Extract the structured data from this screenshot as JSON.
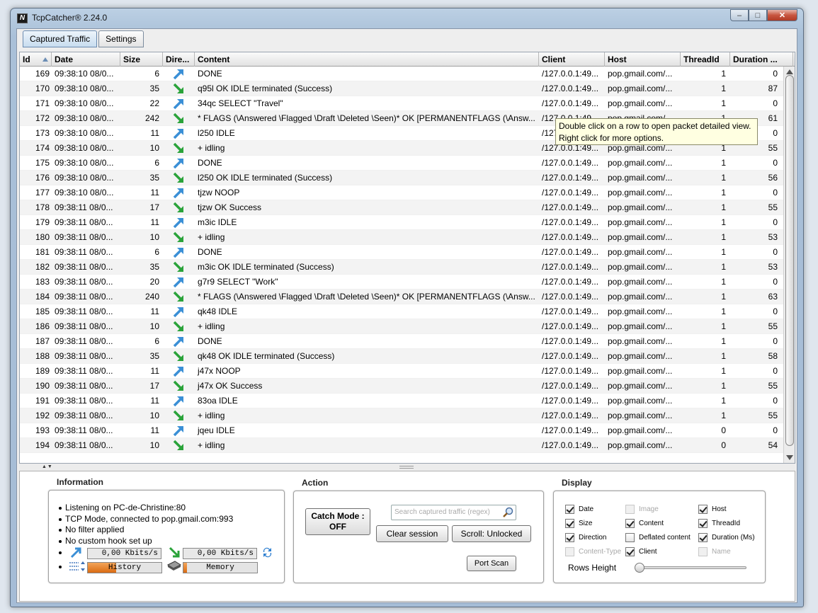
{
  "window": {
    "title": "TcpCatcher®  2.24.0",
    "app_icon_letter": "N"
  },
  "tabs": [
    {
      "label": "Captured Traffic",
      "active": true
    },
    {
      "label": "Settings",
      "active": false
    }
  ],
  "table": {
    "columns": [
      "Id",
      "Date",
      "Size",
      "Dire...",
      "Content",
      "Client",
      "Host",
      "ThreadId",
      "Duration ..."
    ],
    "sorted_column": "Id",
    "rows": [
      {
        "id": "169",
        "date": "09:38:10 08/0...",
        "size": "6",
        "dir": "out",
        "content": "DONE",
        "client": "/127.0.0.1:49...",
        "host": "pop.gmail.com/...",
        "thread": "1",
        "duration": "0"
      },
      {
        "id": "170",
        "date": "09:38:10 08/0...",
        "size": "35",
        "dir": "in",
        "content": "q95l OK IDLE terminated (Success)",
        "client": "/127.0.0.1:49...",
        "host": "pop.gmail.com/...",
        "thread": "1",
        "duration": "87"
      },
      {
        "id": "171",
        "date": "09:38:10 08/0...",
        "size": "22",
        "dir": "out",
        "content": "34qc SELECT \"Travel\"",
        "client": "/127.0.0.1:49...",
        "host": "pop.gmail.com/...",
        "thread": "1",
        "duration": "0"
      },
      {
        "id": "172",
        "date": "09:38:10 08/0...",
        "size": "242",
        "dir": "in",
        "content": "* FLAGS (\\Answered \\Flagged \\Draft \\Deleted \\Seen)* OK [PERMANENTFLAGS (\\Answ...",
        "client": "/127.0.0.1:49...",
        "host": "pop.gmail.com/...",
        "thread": "1",
        "duration": "61"
      },
      {
        "id": "173",
        "date": "09:38:10 08/0...",
        "size": "11",
        "dir": "out",
        "content": "l250 IDLE",
        "client": "/127.0.0.1:49...",
        "host": "pop.gmail.com/...",
        "thread": "1",
        "duration": "0"
      },
      {
        "id": "174",
        "date": "09:38:10 08/0...",
        "size": "10",
        "dir": "in",
        "content": "+ idling",
        "client": "/127.0.0.1:49...",
        "host": "pop.gmail.com/...",
        "thread": "1",
        "duration": "55"
      },
      {
        "id": "175",
        "date": "09:38:10 08/0...",
        "size": "6",
        "dir": "out",
        "content": "DONE",
        "client": "/127.0.0.1:49...",
        "host": "pop.gmail.com/...",
        "thread": "1",
        "duration": "0"
      },
      {
        "id": "176",
        "date": "09:38:10 08/0...",
        "size": "35",
        "dir": "in",
        "content": "l250 OK IDLE terminated (Success)",
        "client": "/127.0.0.1:49...",
        "host": "pop.gmail.com/...",
        "thread": "1",
        "duration": "56"
      },
      {
        "id": "177",
        "date": "09:38:10 08/0...",
        "size": "11",
        "dir": "out",
        "content": "tjzw NOOP",
        "client": "/127.0.0.1:49...",
        "host": "pop.gmail.com/...",
        "thread": "1",
        "duration": "0"
      },
      {
        "id": "178",
        "date": "09:38:11 08/0...",
        "size": "17",
        "dir": "in",
        "content": "tjzw OK Success",
        "client": "/127.0.0.1:49...",
        "host": "pop.gmail.com/...",
        "thread": "1",
        "duration": "55"
      },
      {
        "id": "179",
        "date": "09:38:11 08/0...",
        "size": "11",
        "dir": "out",
        "content": "m3ic IDLE",
        "client": "/127.0.0.1:49...",
        "host": "pop.gmail.com/...",
        "thread": "1",
        "duration": "0"
      },
      {
        "id": "180",
        "date": "09:38:11 08/0...",
        "size": "10",
        "dir": "in",
        "content": "+ idling",
        "client": "/127.0.0.1:49...",
        "host": "pop.gmail.com/...",
        "thread": "1",
        "duration": "53"
      },
      {
        "id": "181",
        "date": "09:38:11 08/0...",
        "size": "6",
        "dir": "out",
        "content": "DONE",
        "client": "/127.0.0.1:49...",
        "host": "pop.gmail.com/...",
        "thread": "1",
        "duration": "0"
      },
      {
        "id": "182",
        "date": "09:38:11 08/0...",
        "size": "35",
        "dir": "in",
        "content": "m3ic OK IDLE terminated (Success)",
        "client": "/127.0.0.1:49...",
        "host": "pop.gmail.com/...",
        "thread": "1",
        "duration": "53"
      },
      {
        "id": "183",
        "date": "09:38:11 08/0...",
        "size": "20",
        "dir": "out",
        "content": "g7r9 SELECT \"Work\"",
        "client": "/127.0.0.1:49...",
        "host": "pop.gmail.com/...",
        "thread": "1",
        "duration": "0"
      },
      {
        "id": "184",
        "date": "09:38:11 08/0...",
        "size": "240",
        "dir": "in",
        "content": "* FLAGS (\\Answered \\Flagged \\Draft \\Deleted \\Seen)* OK [PERMANENTFLAGS (\\Answ...",
        "client": "/127.0.0.1:49...",
        "host": "pop.gmail.com/...",
        "thread": "1",
        "duration": "63"
      },
      {
        "id": "185",
        "date": "09:38:11 08/0...",
        "size": "11",
        "dir": "out",
        "content": "qk48 IDLE",
        "client": "/127.0.0.1:49...",
        "host": "pop.gmail.com/...",
        "thread": "1",
        "duration": "0"
      },
      {
        "id": "186",
        "date": "09:38:11 08/0...",
        "size": "10",
        "dir": "in",
        "content": "+ idling",
        "client": "/127.0.0.1:49...",
        "host": "pop.gmail.com/...",
        "thread": "1",
        "duration": "55"
      },
      {
        "id": "187",
        "date": "09:38:11 08/0...",
        "size": "6",
        "dir": "out",
        "content": "DONE",
        "client": "/127.0.0.1:49...",
        "host": "pop.gmail.com/...",
        "thread": "1",
        "duration": "0"
      },
      {
        "id": "188",
        "date": "09:38:11 08/0...",
        "size": "35",
        "dir": "in",
        "content": "qk48 OK IDLE terminated (Success)",
        "client": "/127.0.0.1:49...",
        "host": "pop.gmail.com/...",
        "thread": "1",
        "duration": "58"
      },
      {
        "id": "189",
        "date": "09:38:11 08/0...",
        "size": "11",
        "dir": "out",
        "content": "j47x NOOP",
        "client": "/127.0.0.1:49...",
        "host": "pop.gmail.com/...",
        "thread": "1",
        "duration": "0"
      },
      {
        "id": "190",
        "date": "09:38:11 08/0...",
        "size": "17",
        "dir": "in",
        "content": "j47x OK Success",
        "client": "/127.0.0.1:49...",
        "host": "pop.gmail.com/...",
        "thread": "1",
        "duration": "55"
      },
      {
        "id": "191",
        "date": "09:38:11 08/0...",
        "size": "11",
        "dir": "out",
        "content": "83oa IDLE",
        "client": "/127.0.0.1:49...",
        "host": "pop.gmail.com/...",
        "thread": "1",
        "duration": "0"
      },
      {
        "id": "192",
        "date": "09:38:11 08/0...",
        "size": "10",
        "dir": "in",
        "content": "+ idling",
        "client": "/127.0.0.1:49...",
        "host": "pop.gmail.com/...",
        "thread": "1",
        "duration": "55"
      },
      {
        "id": "193",
        "date": "09:38:11 08/0...",
        "size": "11",
        "dir": "out",
        "content": "jqeu IDLE",
        "client": "/127.0.0.1:49...",
        "host": "pop.gmail.com/...",
        "thread": "0",
        "duration": "0"
      },
      {
        "id": "194",
        "date": "09:38:11 08/0...",
        "size": "10",
        "dir": "in",
        "content": "+ idling",
        "client": "/127.0.0.1:49...",
        "host": "pop.gmail.com/...",
        "thread": "0",
        "duration": "54"
      }
    ]
  },
  "tooltip": {
    "line1": "Double click on a row to open packet detailed view.",
    "line2": "Right click for more options."
  },
  "information": {
    "title": "Information",
    "lines": [
      "Listening on PC-de-Christine:80",
      "TCP Mode, connected to pop.gmail.com:993",
      "No filter applied",
      "No custom hook set up"
    ],
    "out_rate": "0,00 Kbits/s",
    "in_rate": "0,00 Kbits/s",
    "history_label": "History",
    "history_level": 0.38,
    "memory_label": "Memory",
    "memory_level": 0.05
  },
  "action": {
    "title": "Action",
    "catch_mode_line1": "Catch Mode :",
    "catch_mode_line2": "OFF",
    "search_placeholder": "Search captured traffic (regex)",
    "clear_session": "Clear session",
    "scroll_toggle": "Scroll: Unlocked",
    "port_scan": "Port Scan"
  },
  "display": {
    "title": "Display",
    "options": [
      {
        "label": "Date",
        "checked": true,
        "enabled": true
      },
      {
        "label": "Image",
        "checked": false,
        "enabled": false
      },
      {
        "label": "Host",
        "checked": true,
        "enabled": true
      },
      {
        "label": "Size",
        "checked": true,
        "enabled": true
      },
      {
        "label": "Content",
        "checked": true,
        "enabled": true
      },
      {
        "label": "ThreadId",
        "checked": true,
        "enabled": true
      },
      {
        "label": "Direction",
        "checked": true,
        "enabled": true
      },
      {
        "label": "Deflated content",
        "checked": false,
        "enabled": true
      },
      {
        "label": "Duration (Ms)",
        "checked": true,
        "enabled": true
      },
      {
        "label": "Content-Type",
        "checked": false,
        "enabled": false
      },
      {
        "label": "Client",
        "checked": true,
        "enabled": true
      },
      {
        "label": "Name",
        "checked": false,
        "enabled": false
      }
    ],
    "rows_height_label": "Rows Height",
    "rows_height_level": 0.0
  },
  "colors": {
    "out_arrow": "#3a8fd6",
    "in_arrow": "#2aa33a",
    "bar_fill": "#e07d20"
  }
}
